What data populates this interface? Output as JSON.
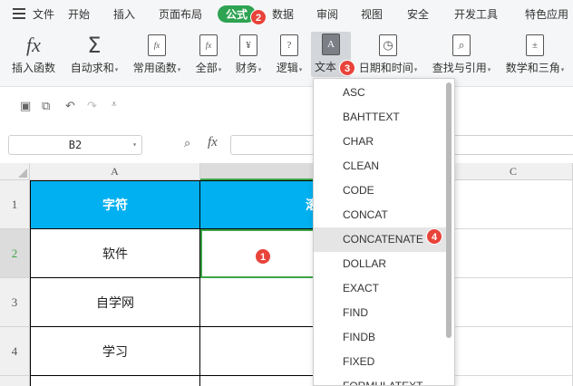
{
  "menubar": {
    "items": [
      "文件",
      "开始",
      "插入",
      "页面布局",
      "公式",
      "数据",
      "审阅",
      "视图",
      "安全",
      "开发工具",
      "特色应用"
    ],
    "active": "公式"
  },
  "ribbon": {
    "buttons": [
      {
        "icon": "fx-icon",
        "glyph": "fx",
        "label": "插入函数"
      },
      {
        "icon": "sigma-icon",
        "glyph": "Σ",
        "label": "自动求和"
      },
      {
        "icon": "star-function-icon",
        "glyph": "fx",
        "label": "常用函数"
      },
      {
        "icon": "all-function-icon",
        "glyph": "fx",
        "label": "全部"
      },
      {
        "icon": "yen-icon",
        "glyph": "¥",
        "label": "财务"
      },
      {
        "icon": "question-icon",
        "glyph": "?",
        "label": "逻辑"
      },
      {
        "icon": "text-icon",
        "glyph": "A",
        "label": "文本"
      },
      {
        "icon": "clock-icon",
        "glyph": "◷",
        "label": "日期和时间"
      },
      {
        "icon": "lookup-icon",
        "glyph": "⌕",
        "label": "查找与引用"
      },
      {
        "icon": "math-icon",
        "glyph": "±",
        "label": "数学和三角"
      }
    ]
  },
  "formula_bar": {
    "name_box": "B2",
    "fx_label": "fx"
  },
  "grid": {
    "columns": [
      "A",
      "C"
    ],
    "rows": [
      "1",
      "2",
      "3",
      "4"
    ],
    "column_a": [
      "字符",
      "软件",
      "自学网",
      "学习"
    ],
    "b1_partial": "滚"
  },
  "dropdown": {
    "items": [
      "ASC",
      "BAHTTEXT",
      "CHAR",
      "CLEAN",
      "CODE",
      "CONCAT",
      "CONCATENATE",
      "DOLLAR",
      "EXACT",
      "FIND",
      "FINDB",
      "FIXED",
      "FORMULATEXT"
    ],
    "highlighted": "CONCATENATE"
  },
  "badges": [
    "1",
    "2",
    "3",
    "4"
  ],
  "colors": {
    "accent_green": "#2ea352",
    "header_fill": "#00b0f0",
    "badge_red": "#e8433a",
    "selection_green": "#3ea447"
  }
}
